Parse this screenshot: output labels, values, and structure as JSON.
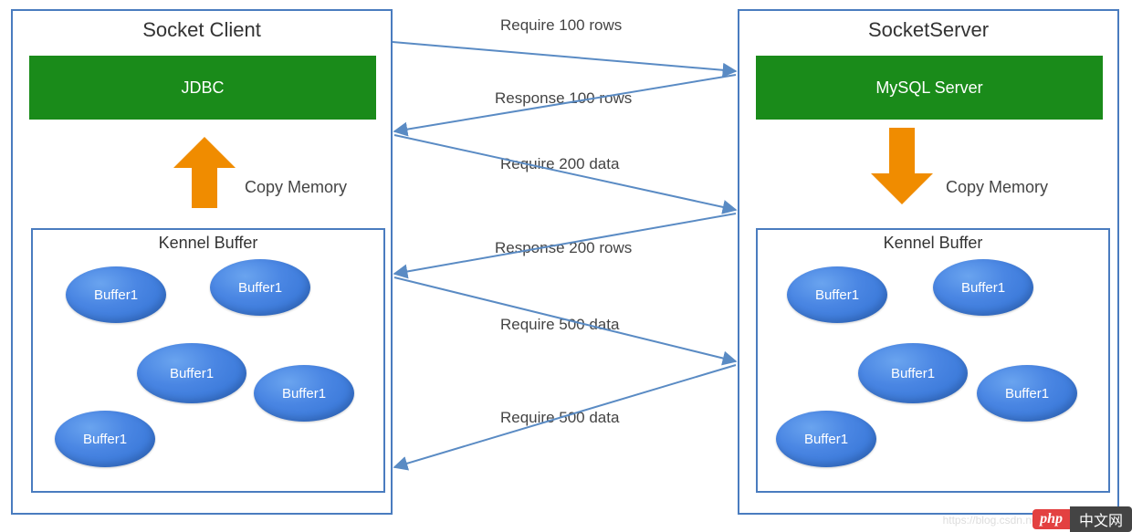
{
  "client": {
    "title": "Socket Client",
    "component": "JDBC",
    "copy_label": "Copy Memory",
    "kennel_title": "Kennel Buffer",
    "buffers": [
      "Buffer1",
      "Buffer1",
      "Buffer1",
      "Buffer1",
      "Buffer1"
    ]
  },
  "server": {
    "title": "SocketServer",
    "component": "MySQL Server",
    "copy_label": "Copy Memory",
    "kennel_title": "Kennel Buffer",
    "buffers": [
      "Buffer1",
      "Buffer1",
      "Buffer1",
      "Buffer1",
      "Buffer1"
    ]
  },
  "messages": {
    "req100": "Require 100 rows",
    "res100": "Response 100 rows",
    "req200": "Require 200 data",
    "res200": "Response 200 rows",
    "req500a": "Require 500 data",
    "req500b": "Require 500 data"
  },
  "watermark": "https://blog.csdn.net",
  "badge": {
    "left": "php",
    "right": "中文网"
  }
}
